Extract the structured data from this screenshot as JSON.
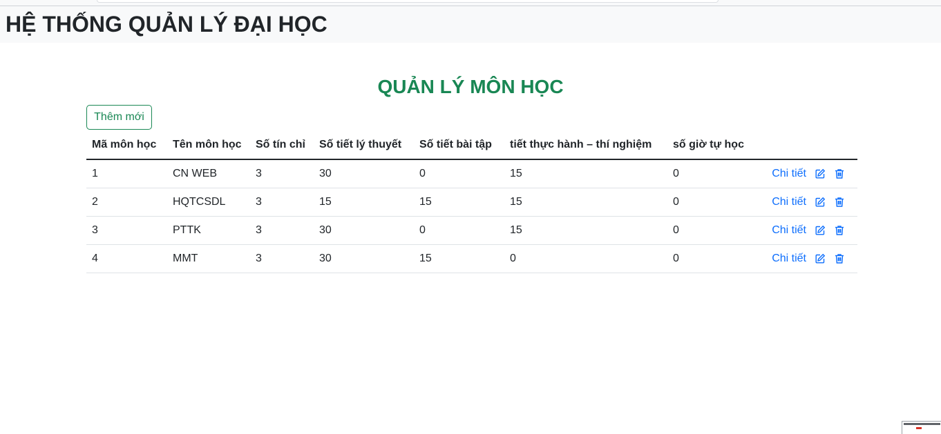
{
  "app": {
    "title": "HỆ THỐNG QUẢN LÝ ĐẠI HỌC"
  },
  "main": {
    "title": "QUẢN LÝ MÔN HỌC",
    "add_label": "Thêm mới"
  },
  "table": {
    "headers": [
      "Mã môn học",
      "Tên môn học",
      "Số tín chỉ",
      "Số tiết lý thuyết",
      "Số tiết bài tập",
      "tiết thực hành – thí nghiệm",
      "số giờ tự học",
      ""
    ],
    "rows": [
      [
        "1",
        "CN WEB",
        "3",
        "30",
        "0",
        "15",
        "0"
      ],
      [
        "2",
        "HQTCSDL",
        "3",
        "15",
        "15",
        "15",
        "0"
      ],
      [
        "3",
        "PTTK",
        "3",
        "30",
        "0",
        "15",
        "0"
      ],
      [
        "4",
        "MMT",
        "3",
        "30",
        "15",
        "0",
        "0"
      ]
    ],
    "detail_label": "Chi tiết",
    "edit_icon": "edit-icon",
    "delete_icon": "trash-icon"
  },
  "colors": {
    "accent": "#198754",
    "link": "#0d6efd",
    "navbar_bg": "#f8f9fa"
  }
}
